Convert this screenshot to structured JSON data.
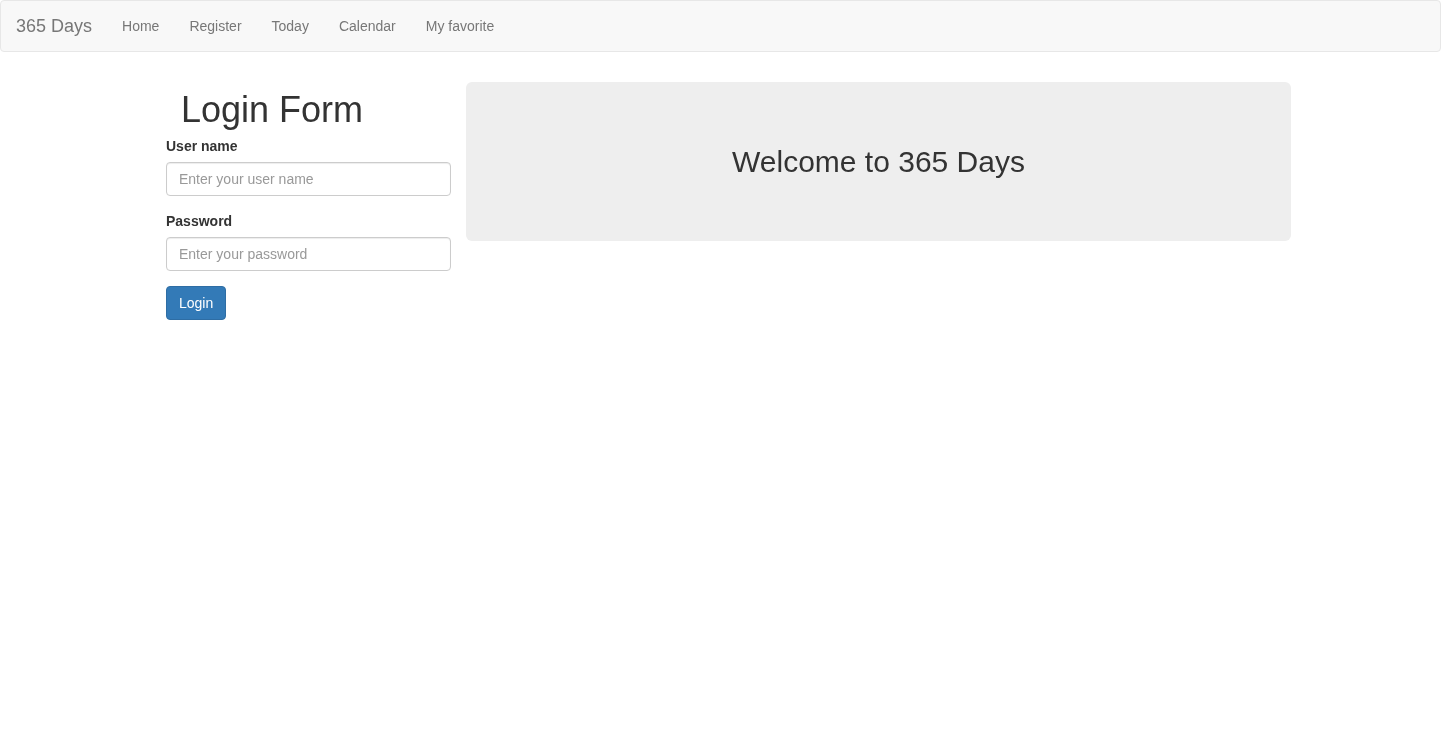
{
  "navbar": {
    "brand": "365 Days",
    "links": [
      "Home",
      "Register",
      "Today",
      "Calendar",
      "My favorite"
    ]
  },
  "login_form": {
    "title": "Login Form",
    "fields": [
      {
        "label": "User name",
        "placeholder": "Enter your user name"
      },
      {
        "label": "Password",
        "placeholder": "Enter your password"
      }
    ],
    "submit_button": "Login"
  },
  "welcome_panel": {
    "heading": "Welcome to 365 Days"
  }
}
